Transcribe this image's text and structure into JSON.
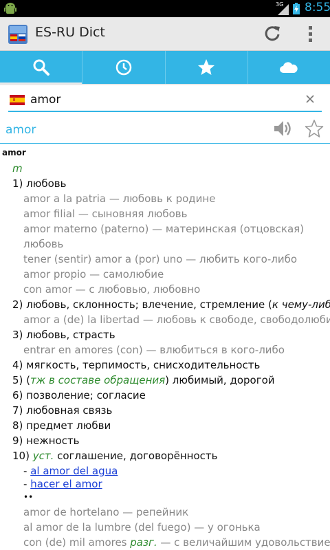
{
  "status_bar": {
    "network": "3G",
    "time": "8:55",
    "colors": {
      "background": "#000000",
      "clock": "#33b5e5"
    },
    "icons": [
      "android-icon",
      "signal-icon",
      "battery-icon"
    ]
  },
  "action_bar": {
    "title": "ES-RU Dict",
    "icons": [
      "app-flags-icon",
      "refresh-icon",
      "overflow-menu-icon"
    ]
  },
  "tabs": [
    {
      "icon": "search-icon",
      "active": true
    },
    {
      "icon": "history-clock-icon",
      "active": false
    },
    {
      "icon": "favorites-star-icon",
      "active": false
    },
    {
      "icon": "cloud-icon",
      "active": false
    }
  ],
  "search": {
    "value": "amor",
    "flag": "spain-flag-icon",
    "clear_icon": "close-icon"
  },
  "headword": {
    "text": "amor",
    "icons": [
      "speaker-icon",
      "star-outline-icon"
    ]
  },
  "article": {
    "headword": "amor",
    "pos": "m",
    "lines": {
      "s1": "1) любовь",
      "e1": "amor a la patria — любовь к родине",
      "e2": "amor filial — сыновняя любовь",
      "e3": "amor materno (paterno) — материнская (отцовская) любовь",
      "e4": "tener (sentir) amor a (por) uno — любить кого-либо",
      "e5": "amor propio — самолюбие",
      "e6": "con amor — с любовью, любовно",
      "s2_text": "2) любовь, склонность; влечение, стремление (",
      "s2_note": "к чему-либо",
      "s2_end": ")",
      "e7": "amor a (de) la libertad — любовь к свободе, свободолюбие",
      "s3": "3) любовь, страсть",
      "e8": "entrar en amores (con) — влюбиться в кого-либо",
      "s4": "4) мягкость, терпимость, снисходительность",
      "s5_open": "5) (",
      "s5_gram": "тж в составе обращения",
      "s5_rest": ") любимый, дорогой",
      "s6": "6) позволение; согласие",
      "s7": "7) любовная связь",
      "s8": "8) предмет любви",
      "s9": "9) нежность",
      "s10_num": "10) ",
      "s10_gram": "уст.",
      "s10_rest": " соглашение, договорённость",
      "link_prefix": "- ",
      "link1": "al amor del agua",
      "link2": "hacer el amor",
      "idioms_marker": "••",
      "e9": "amor de hortelano — репейник",
      "e10": "al amor de la lumbre (del fuego) — у огонька",
      "e11_a": "con (de) mil amores ",
      "e11_gram": "разг.",
      "e11_b": " — с величайшим удовольствием,"
    }
  }
}
